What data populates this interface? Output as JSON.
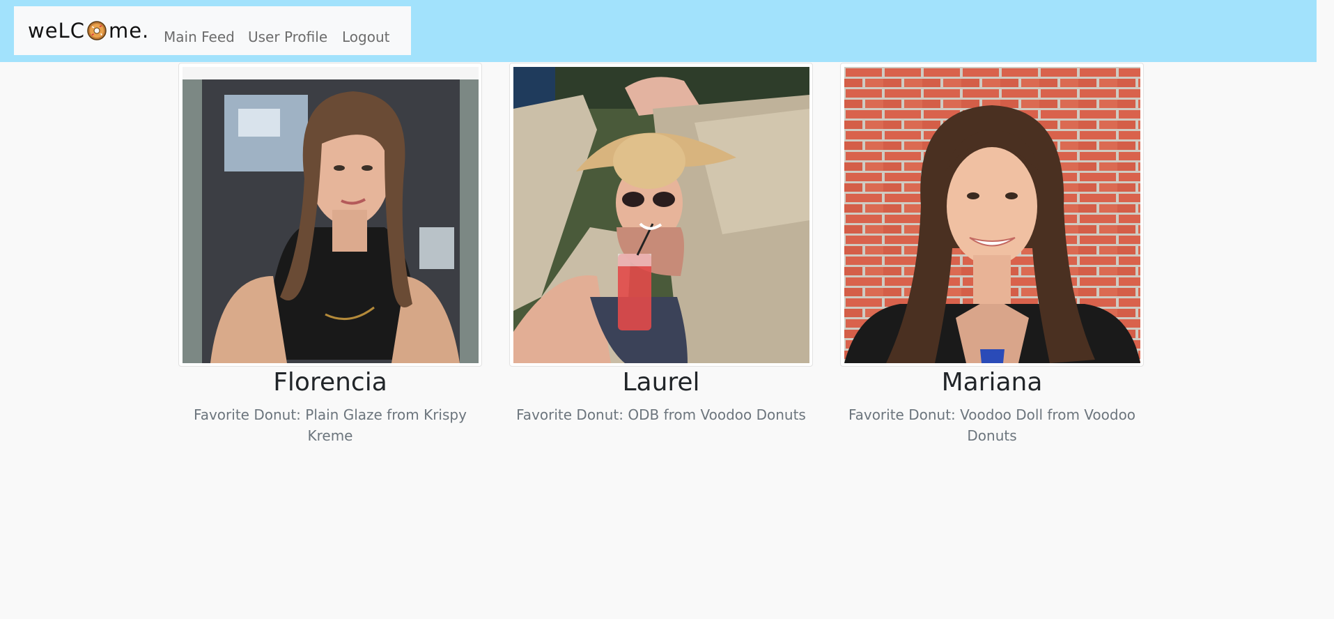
{
  "nav": {
    "brand_left": "weLC",
    "brand_right": "me.",
    "brand_icon": "donut-icon",
    "links": [
      "Main Feed",
      "User Profile",
      "Logout"
    ]
  },
  "profiles": [
    {
      "name": "Florencia",
      "favorite": "Favorite Donut: Plain Glaze from Krispy Kreme"
    },
    {
      "name": "Laurel",
      "favorite": "Favorite Donut: ODB from Voodoo Donuts"
    },
    {
      "name": "Mariana",
      "favorite": "Favorite Donut: Voodoo Doll from Voodoo Donuts"
    }
  ],
  "colors": {
    "topbar": "#a2e2fc",
    "background": "#f9f9f9",
    "brick": "#d9624c"
  }
}
